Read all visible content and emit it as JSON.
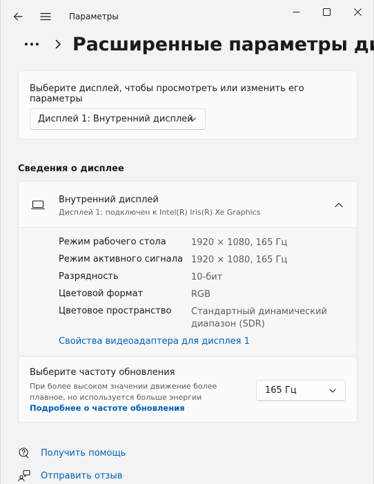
{
  "titlebar": {
    "app_title": "Параметры",
    "icons": [
      "back-arrow-icon",
      "hamburger-menu-icon",
      "minimize-icon",
      "maximize-icon",
      "close-icon"
    ]
  },
  "header": {
    "breadcrumb_more": "•••",
    "page_title": "Расширенные параметры дисплея"
  },
  "display_select": {
    "prompt": "Выберите дисплей, чтобы просмотреть или изменить его параметры",
    "selected": "Дисплей 1: Внутренний дисплей"
  },
  "display_info": {
    "heading": "Сведения о дисплее",
    "title": "Внутренний дисплей",
    "subtitle": "Дисплей 1: подключен к Intel(R) Iris(R) Xe Graphics",
    "specs": [
      {
        "label": "Режим рабочего стола",
        "value": "1920 × 1080, 165 Гц"
      },
      {
        "label": "Режим активного сигнала",
        "value": "1920 × 1080, 165 Гц"
      },
      {
        "label": "Разрядность",
        "value": "10-бит"
      },
      {
        "label": "Цветовой формат",
        "value": "RGB"
      },
      {
        "label": "Цветовое пространство",
        "value": "Стандартный динамический диапазон (SDR)"
      }
    ],
    "adapter_link": "Свойства видеоадаптера для дисплея 1"
  },
  "refresh": {
    "title": "Выберите частоту обновления",
    "description": "При более высоком значении движение более плавное, но используется больше энергии",
    "learn_more": "Подробнее о частоте обновления",
    "selected": "165 Гц"
  },
  "footer": {
    "help": "Получить помощь",
    "feedback": "Отправить отзыв"
  },
  "colors": {
    "accent": "#005fb8",
    "background": "#f3f3f3",
    "card": "#fbfbfb"
  }
}
